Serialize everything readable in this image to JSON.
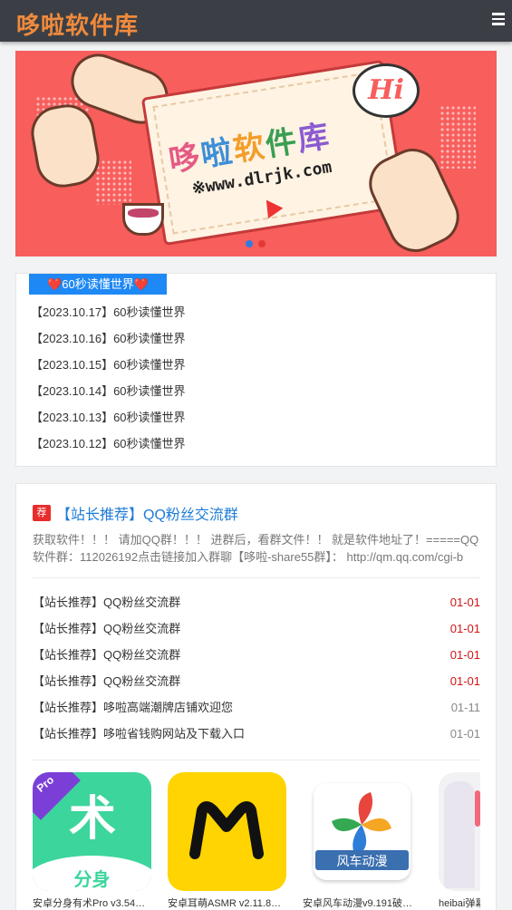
{
  "header": {
    "logo": "哆啦软件库"
  },
  "banner": {
    "title": "哆啦软件库",
    "url": "※www.dlrjk.com",
    "greeting": "Hi",
    "accent": "#f75e5c"
  },
  "news": {
    "tab_label": "❤️60秒读懂世界❤️",
    "items": [
      "【2023.10.17】60秒读懂世界",
      "【2023.10.16】60秒读懂世界",
      "【2023.10.15】60秒读懂世界",
      "【2023.10.14】60秒读懂世界",
      "【2023.10.13】60秒读懂世界",
      "【2023.10.12】60秒读懂世界"
    ]
  },
  "recommend": {
    "badge": "荐",
    "title": "【站长推荐】QQ粉丝交流群",
    "desc_line1": "获取软件！！！ 请加QQ群！！！ 进群后，看群文件！！ 就是软件地址了！=====QQ",
    "desc_line2": "软件群：112026192点击链接加入群聊【哆啦-share55群】：  http://qm.qq.com/cgi-b",
    "list": [
      {
        "title": "【站长推荐】QQ粉丝交流群",
        "date": "01-01",
        "hot": true
      },
      {
        "title": "【站长推荐】QQ粉丝交流群",
        "date": "01-01",
        "hot": true
      },
      {
        "title": "【站长推荐】QQ粉丝交流群",
        "date": "01-01",
        "hot": true
      },
      {
        "title": "【站长推荐】QQ粉丝交流群",
        "date": "01-01",
        "hot": true
      },
      {
        "title": "【站长推荐】哆啦高端潮牌店铺欢迎您",
        "date": "01-11",
        "hot": false
      },
      {
        "title": "【站长推荐】哆啦省钱购网站及下载入口",
        "date": "01-01",
        "hot": false
      }
    ]
  },
  "apps": [
    {
      "caption": "安卓分身有术Pro v3.54…",
      "icon_text": "分身",
      "badge": "Pro",
      "color": "#3cd59c"
    },
    {
      "caption": "安卓耳萌ASMR v2.11.8…",
      "icon_text": "",
      "color": "#ffd400"
    },
    {
      "caption": "安卓风车动漫v9.191破解…",
      "icon_text": "风车动漫",
      "color": "#ffffff"
    },
    {
      "caption": "heibai弹幕",
      "icon_text": "",
      "color": "#f2f2f4"
    }
  ]
}
